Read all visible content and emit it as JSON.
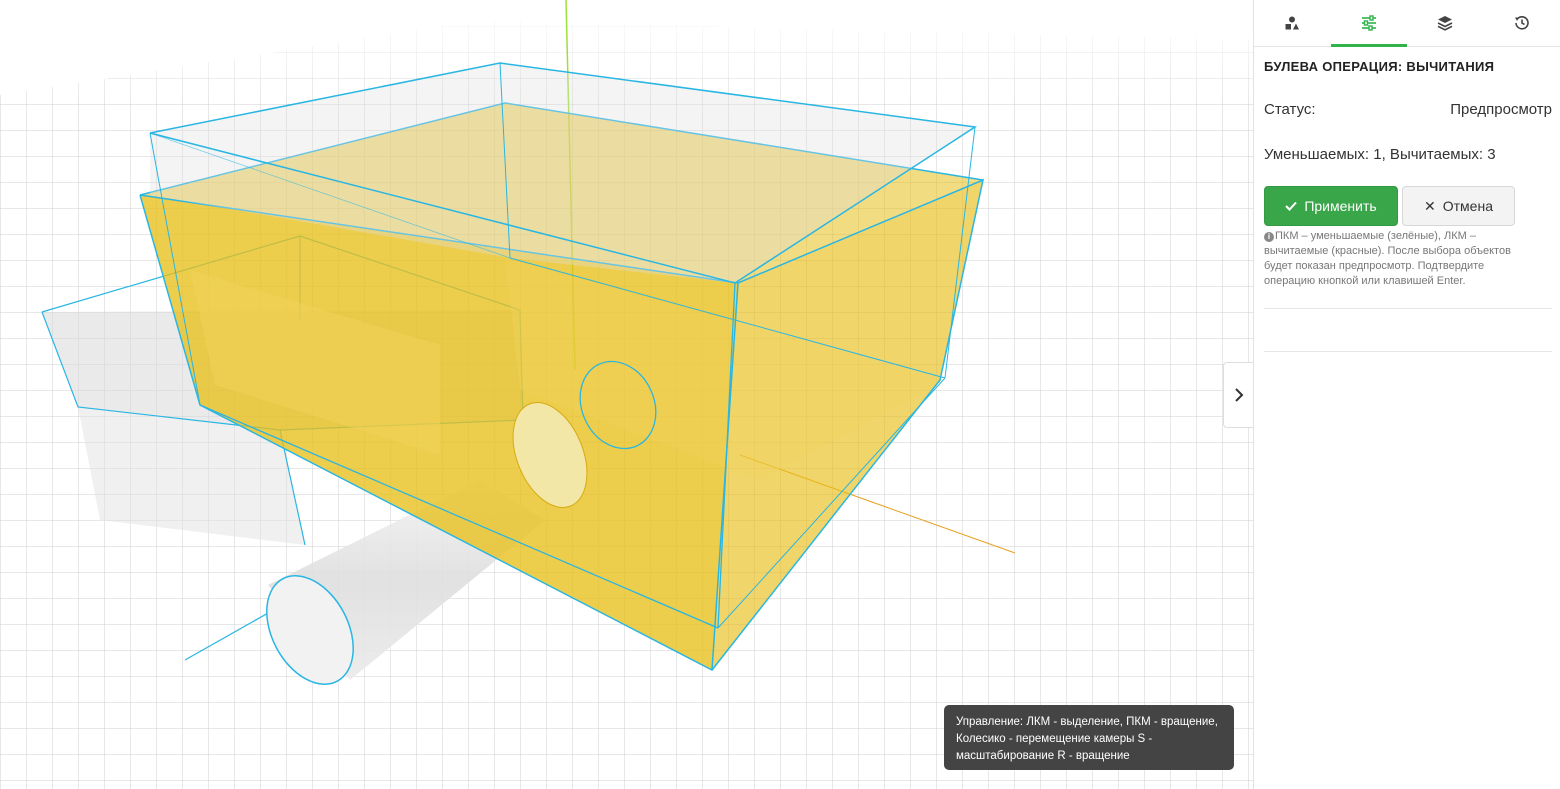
{
  "toolbar_tabs": [
    {
      "icon": "shapes-icon",
      "active": false
    },
    {
      "icon": "sliders-icon",
      "active": true
    },
    {
      "icon": "layers-icon",
      "active": false
    },
    {
      "icon": "history-icon",
      "active": false
    }
  ],
  "panel": {
    "title": "БУЛЕВА ОПЕРАЦИЯ: ВЫЧИТАНИЯ",
    "status_label": "Статус:",
    "status_value": "Предпросмотр",
    "counts_text": "Уменьшаемых: 1, Вычитаемых: 3",
    "apply_label": "Применить",
    "cancel_label": "Отмена",
    "hint": "ПКМ – уменьшаемые (зелёные), ЛКМ – вычитаемые (красные). После выбора объектов будет показан предпросмотр. Подтвердите операцию кнопкой или клавишей Enter."
  },
  "tooltip": {
    "text": "Управление: ЛКМ - выделение, ПКМ - вращение, Колесико - перемещение камеры S - масштабирование R - вращение"
  },
  "colors": {
    "accent": "#3aa64a",
    "solid_fill": "#e8bf1a",
    "outline": "#29b6e3",
    "axis_y": "#9ee03a",
    "axis_x": "#e8a020",
    "tooltip_bg": "#444444"
  }
}
